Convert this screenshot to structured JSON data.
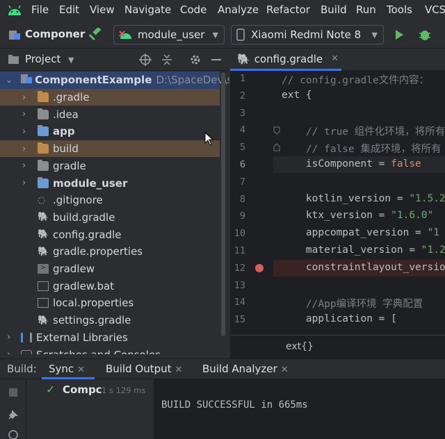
{
  "menubar": {
    "items": [
      "File",
      "Edit",
      "View",
      "Navigate",
      "Code",
      "Analyze",
      "Refactor",
      "Build",
      "Run",
      "Tools",
      "VCS"
    ]
  },
  "toolbar": {
    "project_name": "Componer",
    "run_config": "module_user",
    "device": "Xiaomi Redmi Note 8"
  },
  "project_panel": {
    "title": "Project",
    "root_name": "ComponentExample",
    "root_path": "D:\\SpaceDev\\st",
    "items": [
      {
        "label": ".gradle"
      },
      {
        "label": ".idea"
      },
      {
        "label": "app"
      },
      {
        "label": "build"
      },
      {
        "label": "gradle"
      },
      {
        "label": "module_user"
      },
      {
        "label": ".gitignore"
      },
      {
        "label": "build.gradle"
      },
      {
        "label": "config.gradle"
      },
      {
        "label": "gradle.properties"
      },
      {
        "label": "gradlew"
      },
      {
        "label": "gradlew.bat"
      },
      {
        "label": "local.properties"
      },
      {
        "label": "settings.gradle"
      },
      {
        "label": "External Libraries"
      },
      {
        "label": "Scratches and Consoles"
      }
    ]
  },
  "editor": {
    "tab_label": "config.gradle",
    "line_numbers": [
      "1",
      "2",
      "3",
      "4",
      "5",
      "6",
      "7",
      "8",
      "9",
      "10",
      "11",
      "12",
      "13",
      "14",
      "15"
    ],
    "lines": [
      "// config.gradle文件内容：",
      "ext {",
      "",
      "    // true 组件化环境，将所有",
      "    // false 集成环境，将所有",
      "    isComponent = false",
      "",
      "    kotlin_version = \"1.5.2",
      "    ktx_version = \"1.6.0\"",
      "    appcompat_version = \"1",
      "    material_version = \"1.2",
      "    constraintlayout_versio",
      "",
      "    //App编译环境 字典配置",
      "    application = ["
    ],
    "breadcrumb": "ext{}"
  },
  "build_panel": {
    "label": "Build:",
    "tabs": [
      "Sync",
      "Build Output",
      "Build Analyzer"
    ],
    "tree_item": "Compc",
    "tree_time": "1 s 129 ms",
    "output": "BUILD SUCCESSFUL in 665ms"
  },
  "colors": {
    "accent": "#3574f0",
    "success": "#5fb865",
    "breakpoint": "#db5c5c",
    "run": "#5fb865"
  }
}
